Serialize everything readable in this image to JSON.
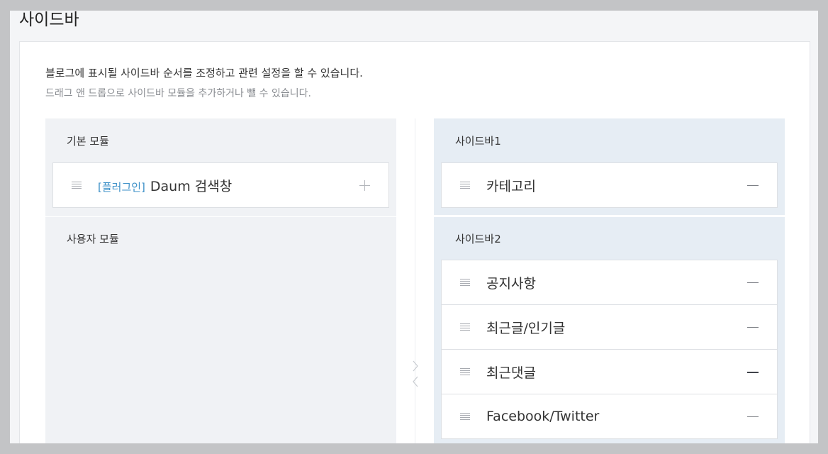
{
  "page": {
    "title": "사이드바",
    "description": "블로그에 표시될 사이드바 순서를 조정하고 관련 설정을 할 수 있습니다.",
    "sub_description": "드래그 앤 드롭으로 사이드바 모듈을 추가하거나 뺄 수 있습니다."
  },
  "left": {
    "basic_modules": {
      "title": "기본 모듈",
      "items": [
        {
          "tag": "[플러그인]",
          "name": "Daum 검색창",
          "action_icon": "plus-icon"
        }
      ]
    },
    "user_modules": {
      "title": "사용자 모듈",
      "items": []
    }
  },
  "right": {
    "sidebar1": {
      "title": "사이드바1",
      "items": [
        {
          "name": "카테고리",
          "action_icon": "minus-icon"
        }
      ]
    },
    "sidebar2": {
      "title": "사이드바2",
      "items": [
        {
          "name": "공지사항",
          "action_icon": "minus-icon"
        },
        {
          "name": "최근글/인기글",
          "action_icon": "minus-icon"
        },
        {
          "name": "최근댓글",
          "action_icon": "minus-icon"
        },
        {
          "name": "Facebook/Twitter",
          "action_icon": "minus-icon"
        }
      ]
    }
  },
  "colors": {
    "accent": "#3a8fc7",
    "module_bg_left": "#f0f2f5",
    "module_bg_right": "#e6edf4"
  },
  "icons": {
    "drag_handle": "drag-handle-icon",
    "move_right": "chevron-right-icon",
    "move_left": "chevron-left-icon"
  }
}
